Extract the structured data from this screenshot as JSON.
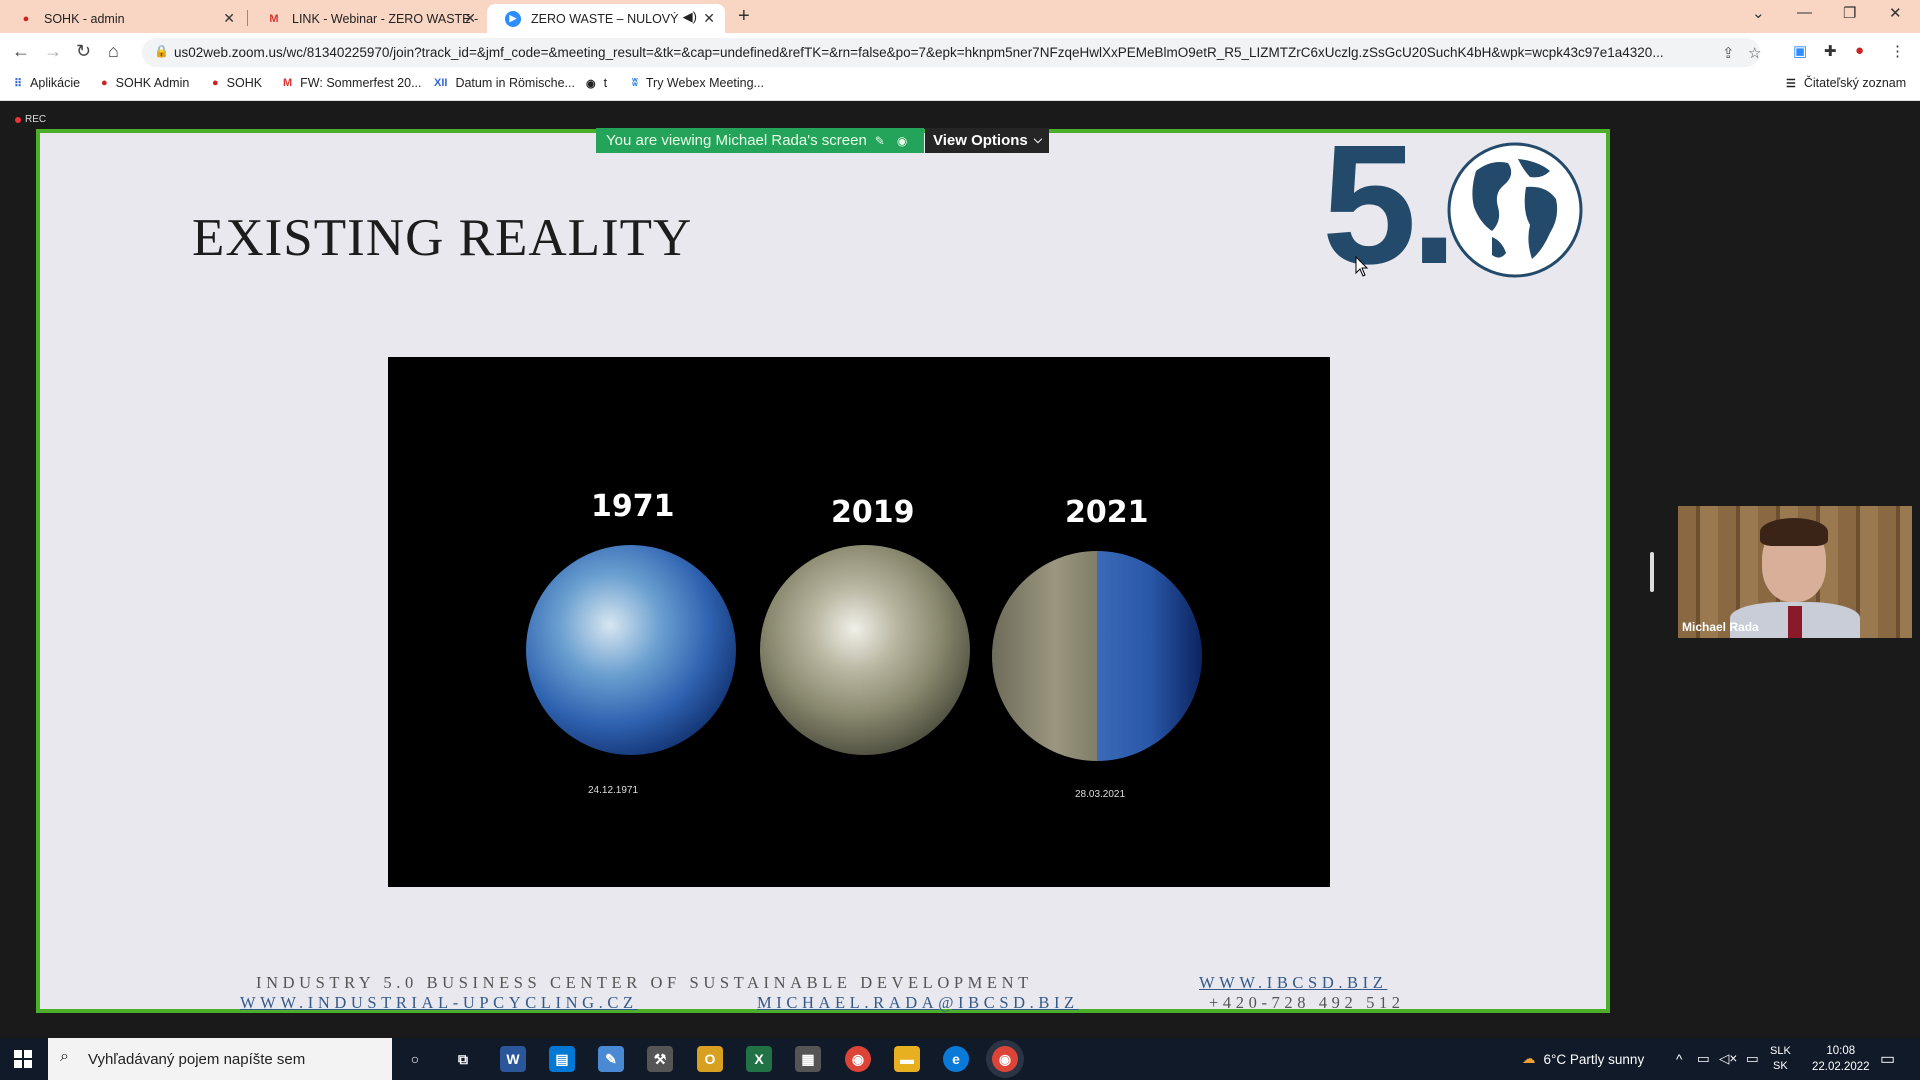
{
  "browser": {
    "tabs": [
      {
        "label": "SOHK - admin",
        "icon": "sohk-favicon"
      },
      {
        "label": "LINK - Webinar - ZERO WASTE -",
        "icon": "gmail-favicon"
      },
      {
        "label": "ZERO WASTE – NULOVÝ OD",
        "icon": "zoom-favicon",
        "active": true
      }
    ],
    "url": "us02web.zoom.us/wc/81340225970/join?track_id=&jmf_code=&meeting_result=&tk=&cap=undefined&refTK=&rn=false&po=7&epk=hknpm5ner7NFzqeHwlXxPEMeBlmO9etR_R5_LIZMTZrC6xUczlg.zSsGcU20SuchK4bH&wpk=wcpk43c97e1a4320..."
  },
  "bookmarks": {
    "apps_label": "Aplikácie",
    "items": [
      {
        "label": "SOHK Admin",
        "icon": "sohk-icon"
      },
      {
        "label": "SOHK",
        "icon": "sohk-icon"
      },
      {
        "label": "FW: Sommerfest 20...",
        "icon": "gmail-icon"
      },
      {
        "label": "Datum in Römische...",
        "icon": "xii-icon"
      },
      {
        "label": "t",
        "icon": "globe-icon"
      },
      {
        "label": "Try Webex Meeting...",
        "icon": "webex-icon"
      }
    ],
    "reading_list": "Čitateľský zoznam"
  },
  "zoom": {
    "rec_label": "REC",
    "banner": "You are viewing Michael Rada's screen",
    "view_options": "View Options",
    "participant_name": "Michael Rada"
  },
  "slide": {
    "title": "EXISTING REALITY",
    "logo_text": "5.",
    "years": [
      "1971",
      "2019",
      "2021"
    ],
    "dates": [
      "24.12.1971",
      "28.03.2021"
    ],
    "footer": {
      "org": "INDUSTRY 5.0 BUSINESS CENTER OF SUSTAINABLE DEVELOPMENT",
      "web": "WWW.IBCSD.BIZ",
      "web2": "WWW.INDUSTRIAL-UPCYCLING.CZ",
      "email": "MICHAEL.RADA@IBCSD.BIZ",
      "phone": "+420-728 492 512"
    }
  },
  "taskbar": {
    "search_placeholder": "Vyhľadávaný pojem napíšte sem",
    "weather": "6°C  Partly sunny",
    "lang": "SLK",
    "lang2": "SK",
    "time": "10:08",
    "date": "22.02.2022"
  }
}
